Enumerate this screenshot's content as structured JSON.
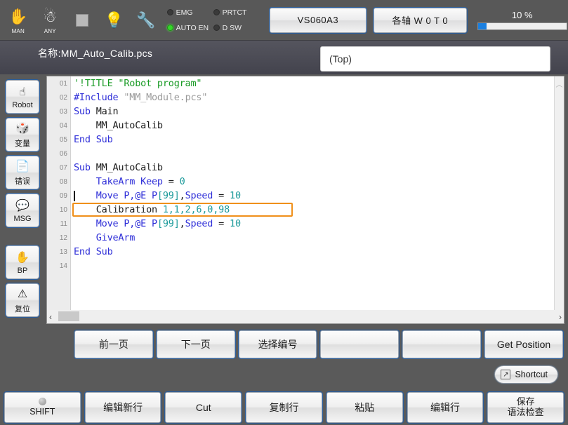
{
  "toolbar": {
    "icons": [
      {
        "name": "hand-icon",
        "glyph": "✋",
        "label": "MAN"
      },
      {
        "name": "avatar-icon",
        "glyph": "☃",
        "label": "ANY"
      },
      {
        "name": "stop-square-icon",
        "glyph": "",
        "label": ""
      },
      {
        "name": "lightbulb-icon",
        "glyph": "💡",
        "label": ""
      },
      {
        "name": "wrench-warning-icon",
        "glyph": "🔧",
        "label": ""
      }
    ],
    "leds": [
      {
        "name": "emg",
        "label": "EMG",
        "on": false
      },
      {
        "name": "prtct",
        "label": "PRTCT",
        "on": false
      },
      {
        "name": "auto-en",
        "label": "AUTO EN",
        "on": true
      },
      {
        "name": "d-sw",
        "label": "D SW",
        "on": false
      }
    ],
    "model_label": "VS060A3",
    "axis_label": "各轴 W 0 T 0",
    "speed_value": "10 %",
    "speed_percent": 10,
    "speed_fill_color": "#1a7fe0"
  },
  "namebar": {
    "filename": "名称:MM_Auto_Calib.pcs",
    "top_field": "(Top)"
  },
  "sidebar": {
    "items": [
      {
        "name": "robot",
        "glyph": "☝",
        "label": "Robot"
      },
      {
        "name": "variable",
        "glyph": "🎲",
        "label": "变量"
      },
      {
        "name": "error",
        "glyph": "📄",
        "label": "错误"
      },
      {
        "name": "message",
        "glyph": "💬",
        "label": "MSG"
      },
      {
        "name": "breakpoint",
        "glyph": "✋",
        "label": "BP"
      },
      {
        "name": "reset",
        "glyph": "⚠",
        "label": "复位"
      }
    ]
  },
  "editor": {
    "selected_line": 10,
    "caret_line": 9,
    "highlight_color": "#f0901a",
    "lines": [
      {
        "num": "01",
        "tokens": [
          {
            "t": "'!TITLE \"Robot program\"",
            "c": "cmt"
          }
        ]
      },
      {
        "num": "02",
        "tokens": [
          {
            "t": "#Include ",
            "c": "kw"
          },
          {
            "t": "\"MM_Module.pcs\"",
            "c": "str"
          }
        ]
      },
      {
        "num": "03",
        "tokens": [
          {
            "t": "Sub ",
            "c": "kw"
          },
          {
            "t": "Main",
            "c": "plain"
          }
        ]
      },
      {
        "num": "04",
        "tokens": [
          {
            "t": "    MM_AutoCalib",
            "c": "plain"
          }
        ]
      },
      {
        "num": "05",
        "tokens": [
          {
            "t": "End Sub",
            "c": "kw"
          }
        ]
      },
      {
        "num": "06",
        "tokens": [
          {
            "t": "",
            "c": "plain"
          }
        ]
      },
      {
        "num": "07",
        "tokens": [
          {
            "t": "Sub ",
            "c": "kw"
          },
          {
            "t": "MM_AutoCalib",
            "c": "plain"
          }
        ]
      },
      {
        "num": "08",
        "tokens": [
          {
            "t": "    ",
            "c": "plain"
          },
          {
            "t": "TakeArm Keep",
            "c": "kw"
          },
          {
            "t": " = ",
            "c": "plain"
          },
          {
            "t": "0",
            "c": "num"
          }
        ]
      },
      {
        "num": "09",
        "tokens": [
          {
            "t": "    ",
            "c": "plain"
          },
          {
            "t": "Move P,@E P",
            "c": "kw"
          },
          {
            "t": "[99]",
            "c": "num"
          },
          {
            "t": ",",
            "c": "plain"
          },
          {
            "t": "Speed",
            "c": "kw"
          },
          {
            "t": " = ",
            "c": "plain"
          },
          {
            "t": "10",
            "c": "num"
          }
        ]
      },
      {
        "num": "10",
        "tokens": [
          {
            "t": "    ",
            "c": "plain"
          },
          {
            "t": "Calibration ",
            "c": "plain"
          },
          {
            "t": "1,1,2,6,0,98",
            "c": "num"
          }
        ]
      },
      {
        "num": "11",
        "tokens": [
          {
            "t": "    ",
            "c": "plain"
          },
          {
            "t": "Move P,@E P",
            "c": "kw"
          },
          {
            "t": "[99]",
            "c": "num"
          },
          {
            "t": ",",
            "c": "plain"
          },
          {
            "t": "Speed",
            "c": "kw"
          },
          {
            "t": " = ",
            "c": "plain"
          },
          {
            "t": "10",
            "c": "num"
          }
        ]
      },
      {
        "num": "12",
        "tokens": [
          {
            "t": "    ",
            "c": "plain"
          },
          {
            "t": "GiveArm",
            "c": "kw"
          }
        ]
      },
      {
        "num": "13",
        "tokens": [
          {
            "t": "End Sub",
            "c": "kw"
          }
        ]
      },
      {
        "num": "14",
        "tokens": [
          {
            "t": "",
            "c": "plain"
          }
        ]
      }
    ],
    "scroll_up_glyph": "︿",
    "scroll_down_glyph": "﹀",
    "scroll_left_glyph": "‹",
    "scroll_right_glyph": "›"
  },
  "function_row": [
    {
      "name": "prev-page",
      "label": "前一页"
    },
    {
      "name": "next-page",
      "label": "下一页"
    },
    {
      "name": "select-number",
      "label": "选择编号"
    },
    {
      "name": "blank-1",
      "label": ""
    },
    {
      "name": "blank-2",
      "label": ""
    },
    {
      "name": "get-position",
      "label": "Get Position"
    }
  ],
  "shortcut": {
    "label": "Shortcut",
    "icon": "↗"
  },
  "bottom_row": [
    {
      "name": "shift",
      "label": "SHIFT",
      "has_dot": true,
      "line2": ""
    },
    {
      "name": "edit-new-line",
      "label": "编辑新行",
      "has_dot": false,
      "line2": ""
    },
    {
      "name": "cut",
      "label": "Cut",
      "has_dot": false,
      "line2": ""
    },
    {
      "name": "copy-line",
      "label": "复制行",
      "has_dot": false,
      "line2": ""
    },
    {
      "name": "paste",
      "label": "粘贴",
      "has_dot": false,
      "line2": ""
    },
    {
      "name": "edit-line",
      "label": "编辑行",
      "has_dot": false,
      "line2": ""
    },
    {
      "name": "save-syntax-check",
      "label": "保存",
      "has_dot": false,
      "line2": "语法检查"
    }
  ]
}
